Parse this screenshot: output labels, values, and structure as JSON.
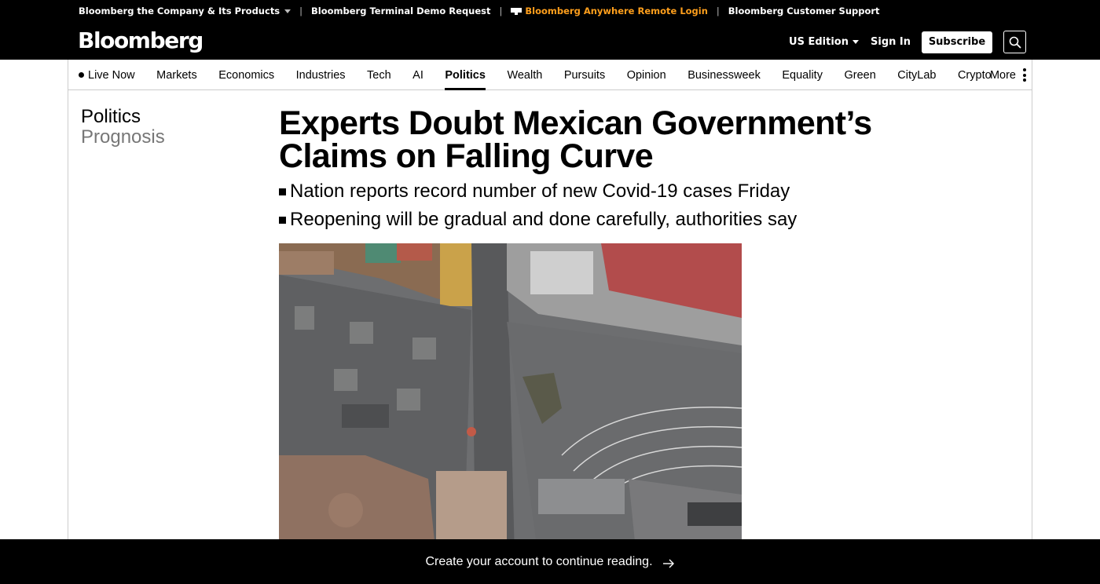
{
  "utility": {
    "company_products": "Bloomberg the Company & Its Products",
    "terminal_demo": "Bloomberg Terminal Demo Request",
    "anywhere_login": "Bloomberg Anywhere Remote Login",
    "customer_support": "Bloomberg Customer Support",
    "accent_color": "#ff9f1c"
  },
  "masthead": {
    "logo": "Bloomberg",
    "edition": "US Edition",
    "sign_in": "Sign In",
    "subscribe": "Subscribe",
    "search_icon": "search-icon"
  },
  "nav": {
    "items": [
      {
        "label": "Live Now"
      },
      {
        "label": "Markets"
      },
      {
        "label": "Economics"
      },
      {
        "label": "Industries"
      },
      {
        "label": "Tech"
      },
      {
        "label": "AI"
      },
      {
        "label": "Politics",
        "active": true
      },
      {
        "label": "Wealth"
      },
      {
        "label": "Pursuits"
      },
      {
        "label": "Opinion"
      },
      {
        "label": "Businessweek"
      },
      {
        "label": "Equality"
      },
      {
        "label": "Green"
      },
      {
        "label": "CityLab"
      },
      {
        "label": "Crypto"
      }
    ],
    "more": "More"
  },
  "rail": {
    "section": "Politics",
    "subsection": "Prognosis"
  },
  "article": {
    "headline": "Experts Doubt Mexican Government’s Claims on Falling Curve",
    "bullets": [
      "Nation reports record number of new Covid-19 cases Friday",
      "Reopening will be gradual and done carefully, authorities say"
    ]
  },
  "banner": {
    "text": "Create your account to continue reading."
  }
}
